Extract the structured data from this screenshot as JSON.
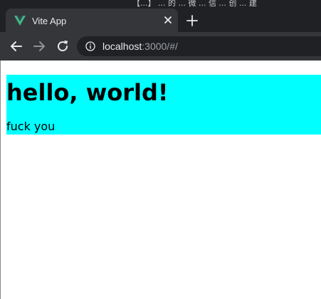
{
  "browser": {
    "tab_title": "Vite App",
    "tab_close_icon": "close-icon",
    "new_tab_icon": "plus-icon",
    "url_host": "localhost",
    "url_rest": ":3000/#/",
    "background_window_text": "【...】 ... 的 ... 微 ... 信 ... 创 ... 建"
  },
  "page": {
    "heading": "hello, world!",
    "paragraph": "fuck you"
  },
  "colors": {
    "chrome_dark": "#202124",
    "chrome_tab": "#35363a",
    "app_background": "#00ffff",
    "vite_logo_green": "#41b883"
  }
}
